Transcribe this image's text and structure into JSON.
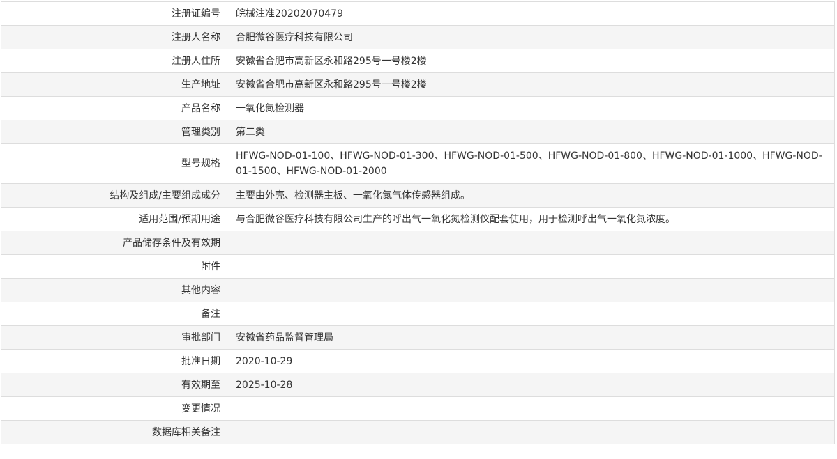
{
  "rows": [
    {
      "label": "注册证编号",
      "value": "皖械注准20202070479"
    },
    {
      "label": "注册人名称",
      "value": "合肥微谷医疗科技有限公司"
    },
    {
      "label": "注册人住所",
      "value": "安徽省合肥市高新区永和路295号一号楼2楼"
    },
    {
      "label": "生产地址",
      "value": "安徽省合肥市高新区永和路295号一号楼2楼"
    },
    {
      "label": "产品名称",
      "value": "一氧化氮检测器"
    },
    {
      "label": "管理类别",
      "value": "第二类"
    },
    {
      "label": "型号规格",
      "value": "HFWG-NOD-01-100、HFWG-NOD-01-300、HFWG-NOD-01-500、HFWG-NOD-01-800、HFWG-NOD-01-1000、HFWG-NOD-01-1500、HFWG-NOD-01-2000"
    },
    {
      "label": "结构及组成/主要组成成分",
      "value": "主要由外壳、检测器主板、一氧化氮气体传感器组成。"
    },
    {
      "label": "适用范围/预期用途",
      "value": "与合肥微谷医疗科技有限公司生产的呼出气一氧化氮检测仪配套使用，用于检测呼出气一氧化氮浓度。"
    },
    {
      "label": "产品储存条件及有效期",
      "value": ""
    },
    {
      "label": "附件",
      "value": ""
    },
    {
      "label": "其他内容",
      "value": ""
    },
    {
      "label": "备注",
      "value": ""
    },
    {
      "label": "审批部门",
      "value": "安徽省药品监督管理局"
    },
    {
      "label": "批准日期",
      "value": "2020-10-29"
    },
    {
      "label": "有效期至",
      "value": "2025-10-28"
    },
    {
      "label": "变更情况",
      "value": ""
    },
    {
      "label": "数据库相关备注",
      "value": ""
    }
  ]
}
